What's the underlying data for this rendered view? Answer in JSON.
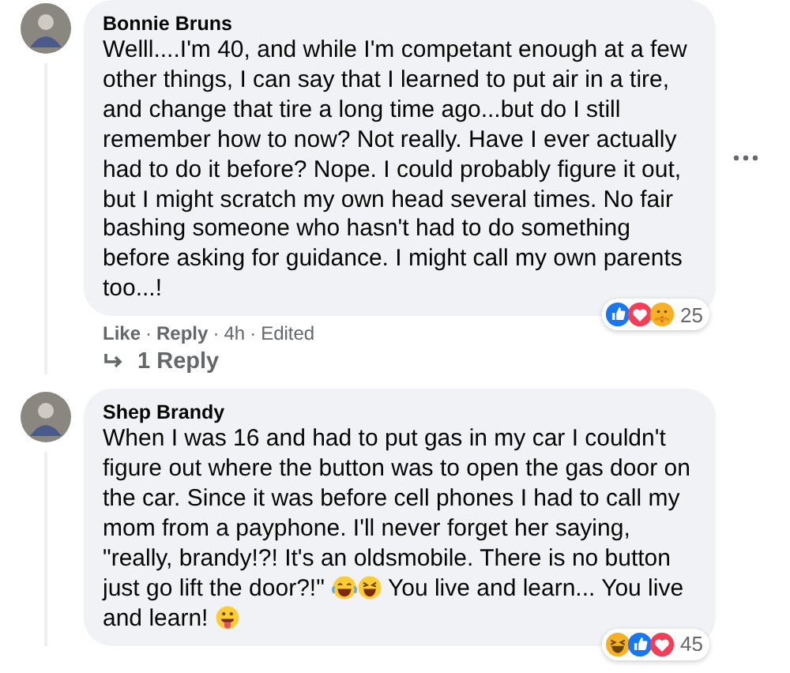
{
  "comments": [
    {
      "author": "Bonnie Bruns",
      "body": [
        {
          "kind": "text",
          "text": "Welll....I'm 40, and while I'm competant enough at a few other things, I can say that I learned to put air in a tire, and change that tire a long time ago...but do I still remember how to now? Not really. Have I ever actually had to do it before? Nope. I could probably figure it out, but I might scratch my own head several times. No fair bashing someone who hasn't had to do something before asking for guidance. I might call my own parents too...!"
        }
      ],
      "reactions": [
        {
          "kind": "like"
        },
        {
          "kind": "love"
        },
        {
          "kind": "care"
        }
      ],
      "reaction_count": "25",
      "separator": "·",
      "actions": [
        "Like",
        "Reply"
      ],
      "time": "4h",
      "edited": "Edited",
      "replies": "1 Reply",
      "has_menu": true
    },
    {
      "author": "Shep Brandy",
      "body": [
        {
          "kind": "text",
          "text": "When I was 16 and had to put gas in my car I couldn't figure out where the button was to open the gas door on the car. Since it was before cell phones I had to call my mom from a payphone. I'll never forget her saying, \"really, brandy!?! It's an oldsmobile. There is no button just go lift the door?!\" "
        },
        {
          "kind": "tears"
        },
        {
          "kind": "rofl"
        },
        {
          "kind": "text",
          "text": " You live and learn... You live and learn! "
        },
        {
          "kind": "tongue"
        }
      ],
      "reactions": [
        {
          "kind": "haha"
        },
        {
          "kind": "like"
        },
        {
          "kind": "love"
        }
      ],
      "reaction_count": "45",
      "has_menu": false
    }
  ]
}
